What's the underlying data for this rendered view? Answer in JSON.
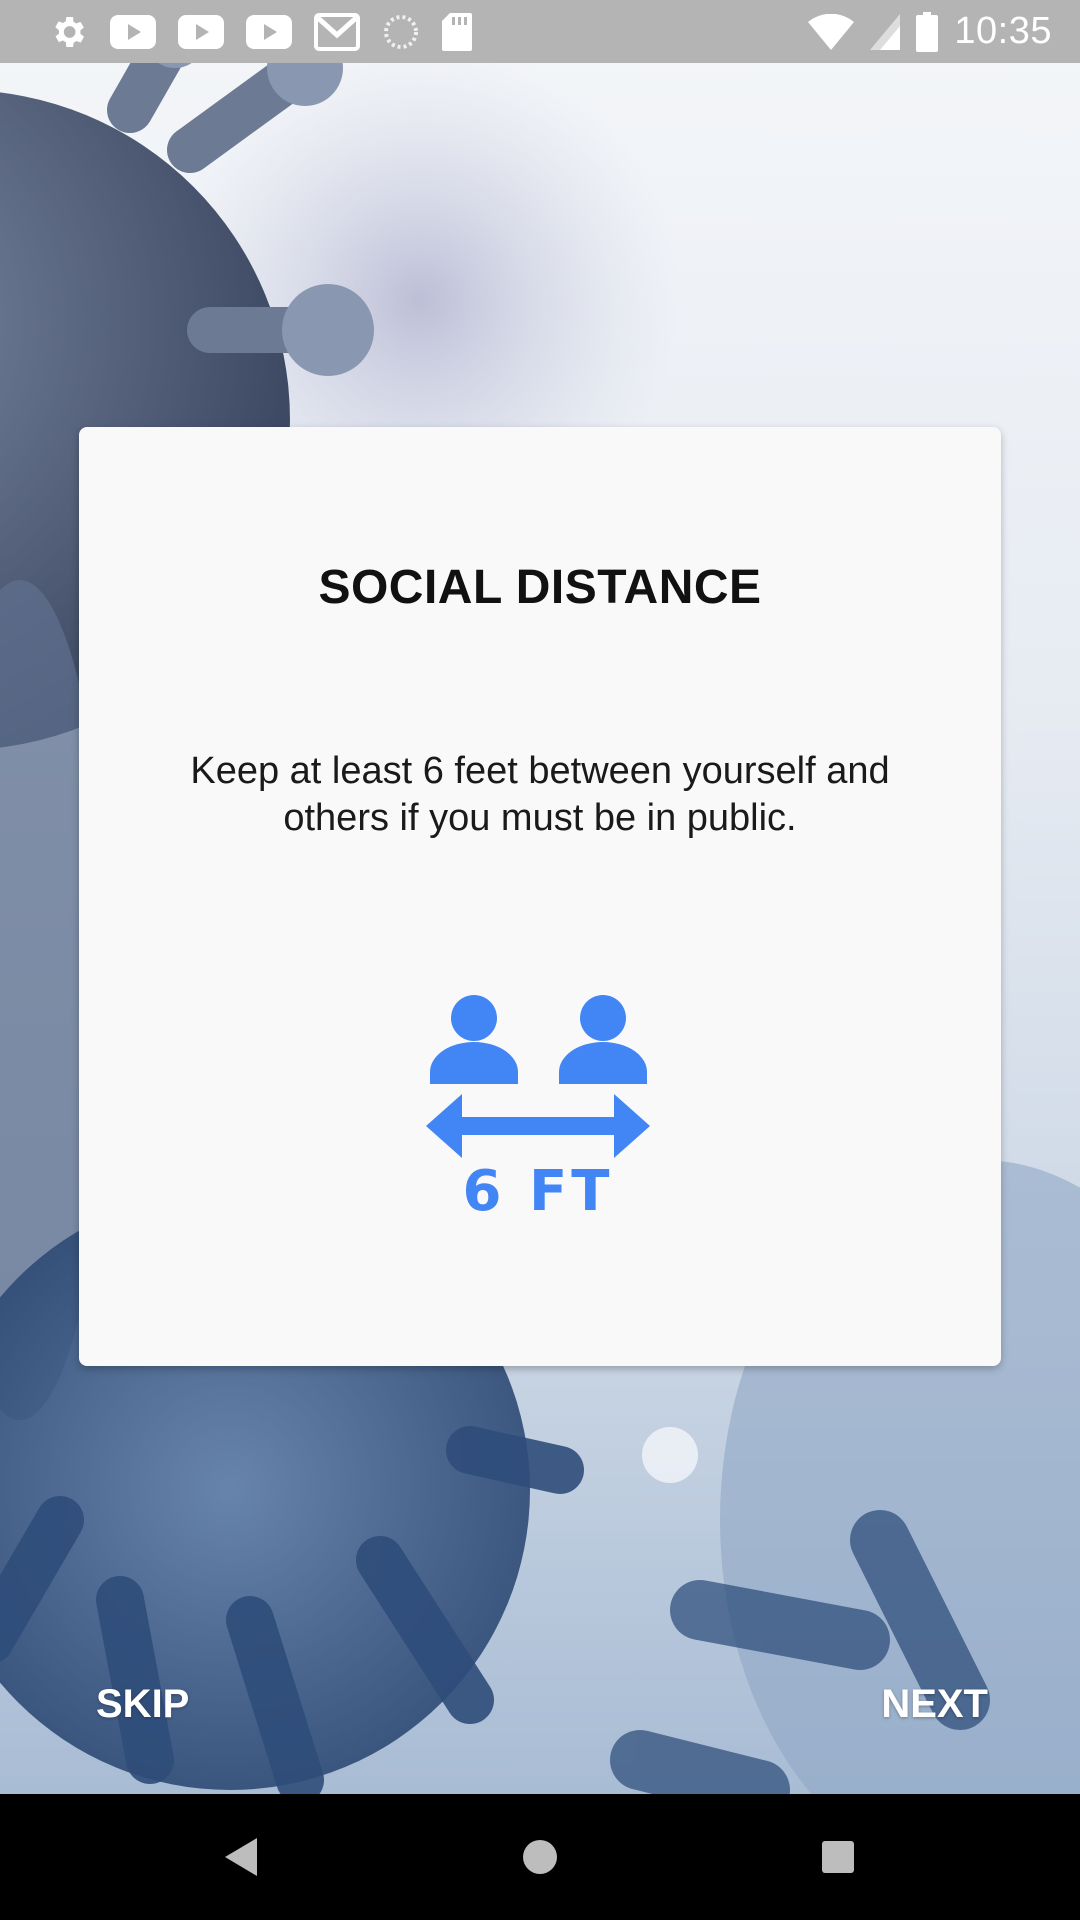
{
  "status_bar": {
    "time": "10:35",
    "left_icons": [
      "gear-icon",
      "youtube-icon",
      "youtube-icon",
      "youtube-icon",
      "gmail-icon",
      "loading-icon",
      "sd-card-icon"
    ],
    "right_icons": [
      "wifi-icon",
      "signal-icon",
      "battery-icon"
    ]
  },
  "card": {
    "title": "SOCIAL DISTANCE",
    "description": "Keep at least 6 feet between yourself and others if you must be in public.",
    "illustration_label": "6 FT",
    "illustration_icon": "social-distance-icon",
    "accent_color": "#4285f4"
  },
  "actions": {
    "skip_label": "SKIP",
    "next_label": "NEXT"
  },
  "nav_bar": {
    "buttons": [
      "back-icon",
      "home-icon",
      "recents-icon"
    ]
  }
}
